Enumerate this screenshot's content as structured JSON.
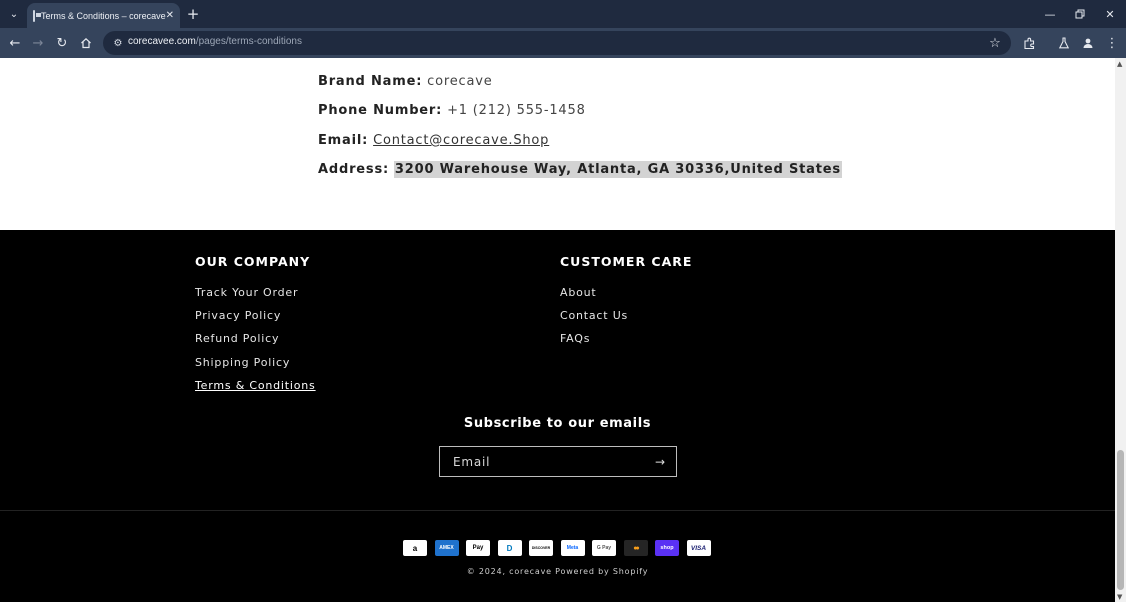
{
  "browser": {
    "tab_title": "Terms & Conditions – corecave",
    "url_host": "corecavee.com",
    "url_path": "/pages/terms-conditions"
  },
  "content": {
    "brand_label": "Brand Name:",
    "brand_value": "corecave",
    "phone_label": "Phone Number:",
    "phone_value": "+1 (212) 555-1458",
    "email_label": "Email:",
    "email_value": "Contact@corecave.Shop",
    "address_label": "Address:",
    "address_value": "3200 Warehouse Way, Atlanta, GA 30336,United States"
  },
  "footer": {
    "company_heading": "OUR COMPANY",
    "company_links": [
      "Track Your Order",
      "Privacy Policy",
      "Refund Policy",
      "Shipping Policy",
      "Terms & Conditions"
    ],
    "care_heading": "CUSTOMER CARE",
    "care_links": [
      "About",
      "Contact Us",
      "FAQs"
    ],
    "subscribe_heading": "Subscribe to our emails",
    "email_placeholder": "Email",
    "payment_methods": [
      "Amazon",
      "American Express",
      "Apple Pay",
      "Diners Club",
      "Discover",
      "Meta Pay",
      "Google Pay",
      "Mastercard",
      "Shop Pay",
      "Visa"
    ],
    "payment_marks": [
      "a",
      "AMEX",
      "Pay",
      "D",
      "DISCOVER",
      "Meta",
      "G Pay",
      "●●",
      "shop",
      "VISA"
    ],
    "copyright_prefix": "© 2024,",
    "copyright_brand": "corecave",
    "copyright_powered": "Powered by Shopify"
  },
  "colors": {
    "chrome_dark": "#1f2a3f",
    "chrome_tab": "#35445c",
    "footer_bg": "#000000",
    "highlight": "#d3d3d3"
  }
}
